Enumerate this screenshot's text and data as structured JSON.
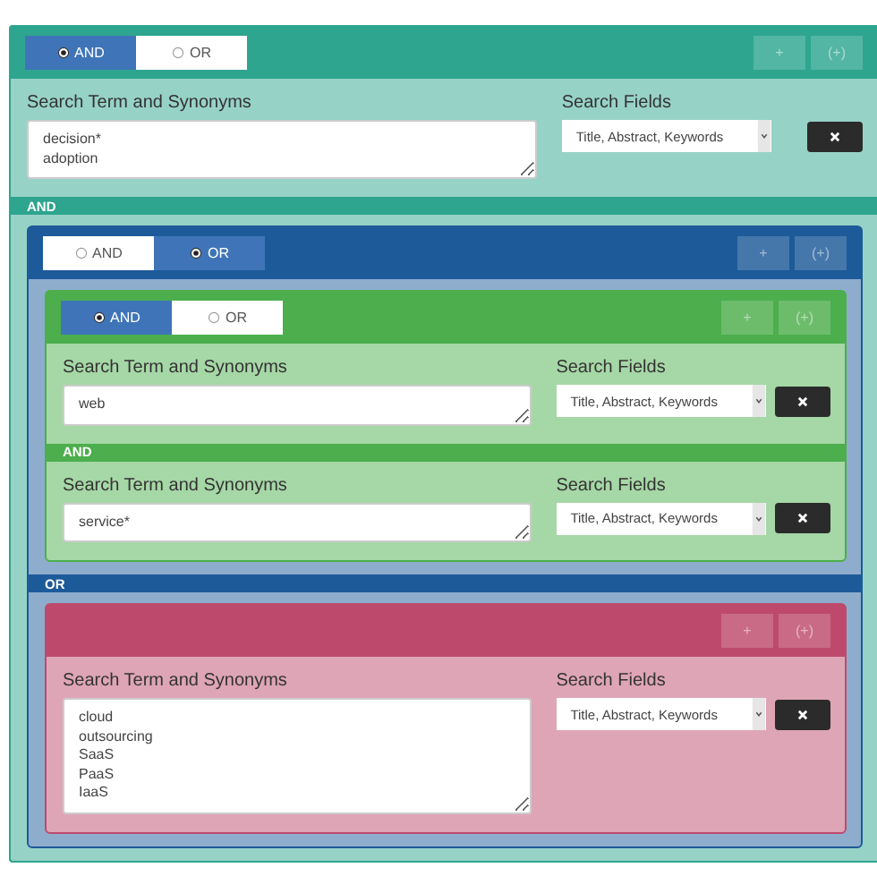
{
  "root": {
    "kind": "group",
    "color": "#2ea58f",
    "toggle": [
      {
        "label": "AND",
        "selected": true
      },
      {
        "label": "OR",
        "selected": false
      }
    ],
    "header_buttons": [
      {
        "label": "+",
        "disabled": true
      },
      {
        "label": "(+)",
        "disabled": true
      }
    ],
    "items": [
      {
        "kind": "term",
        "term_label": "Search Term and Synonyms",
        "lines": [
          "decision*",
          "adoption"
        ],
        "fields_label": "Search Fields",
        "fields_value": "Title, Abstract, Keywords"
      },
      {
        "kind": "connector",
        "label": "AND"
      },
      {
        "kind": "group",
        "color": "#1d5a99",
        "toggle": [
          {
            "label": "AND",
            "selected": false
          },
          {
            "label": "OR",
            "selected": true
          }
        ],
        "header_buttons": [
          {
            "label": "+",
            "disabled": true
          },
          {
            "label": "(+)",
            "disabled": true
          }
        ],
        "items": [
          {
            "kind": "group",
            "color": "#4cae4c",
            "toggle": [
              {
                "label": "AND",
                "selected": true
              },
              {
                "label": "OR",
                "selected": false
              }
            ],
            "header_buttons": [
              {
                "label": "+",
                "disabled": true
              },
              {
                "label": "(+)",
                "disabled": true
              }
            ],
            "items": [
              {
                "kind": "term",
                "term_label": "Search Term and Synonyms",
                "lines": [
                  "web"
                ],
                "fields_label": "Search Fields",
                "fields_value": "Title, Abstract, Keywords"
              },
              {
                "kind": "connector",
                "label": "AND"
              },
              {
                "kind": "term",
                "term_label": "Search Term and Synonyms",
                "lines": [
                  "service*"
                ],
                "fields_label": "Search Fields",
                "fields_value": "Title, Abstract, Keywords"
              }
            ]
          },
          {
            "kind": "connector",
            "label": "OR"
          },
          {
            "kind": "group",
            "color": "#bd4a6d",
            "header_buttons": [
              {
                "label": "+",
                "disabled": true
              },
              {
                "label": "(+)",
                "disabled": true
              }
            ],
            "items": [
              {
                "kind": "term",
                "term_label": "Search Term and Synonyms",
                "lines": [
                  "cloud",
                  "outsourcing",
                  "SaaS",
                  "PaaS",
                  "IaaS"
                ],
                "fields_label": "Search Fields",
                "fields_value": "Title, Abstract, Keywords"
              }
            ]
          }
        ]
      }
    ]
  }
}
